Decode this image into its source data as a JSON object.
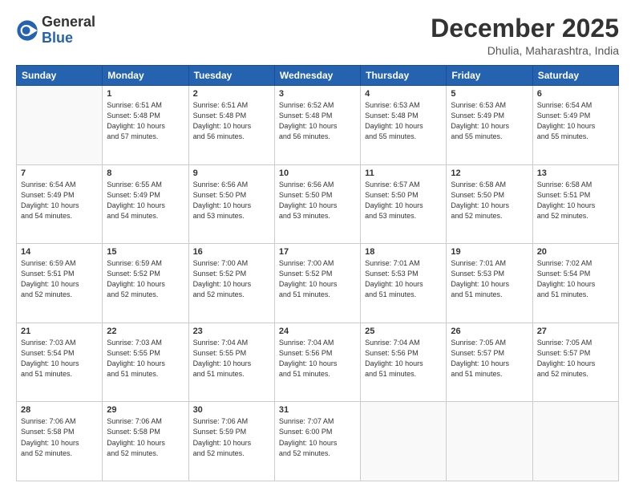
{
  "logo": {
    "general": "General",
    "blue": "Blue"
  },
  "header": {
    "month_year": "December 2025",
    "location": "Dhulia, Maharashtra, India"
  },
  "days_of_week": [
    "Sunday",
    "Monday",
    "Tuesday",
    "Wednesday",
    "Thursday",
    "Friday",
    "Saturday"
  ],
  "weeks": [
    [
      {
        "day": "",
        "info": ""
      },
      {
        "day": "1",
        "info": "Sunrise: 6:51 AM\nSunset: 5:48 PM\nDaylight: 10 hours\nand 57 minutes."
      },
      {
        "day": "2",
        "info": "Sunrise: 6:51 AM\nSunset: 5:48 PM\nDaylight: 10 hours\nand 56 minutes."
      },
      {
        "day": "3",
        "info": "Sunrise: 6:52 AM\nSunset: 5:48 PM\nDaylight: 10 hours\nand 56 minutes."
      },
      {
        "day": "4",
        "info": "Sunrise: 6:53 AM\nSunset: 5:48 PM\nDaylight: 10 hours\nand 55 minutes."
      },
      {
        "day": "5",
        "info": "Sunrise: 6:53 AM\nSunset: 5:49 PM\nDaylight: 10 hours\nand 55 minutes."
      },
      {
        "day": "6",
        "info": "Sunrise: 6:54 AM\nSunset: 5:49 PM\nDaylight: 10 hours\nand 55 minutes."
      }
    ],
    [
      {
        "day": "7",
        "info": "Sunrise: 6:54 AM\nSunset: 5:49 PM\nDaylight: 10 hours\nand 54 minutes."
      },
      {
        "day": "8",
        "info": "Sunrise: 6:55 AM\nSunset: 5:49 PM\nDaylight: 10 hours\nand 54 minutes."
      },
      {
        "day": "9",
        "info": "Sunrise: 6:56 AM\nSunset: 5:50 PM\nDaylight: 10 hours\nand 53 minutes."
      },
      {
        "day": "10",
        "info": "Sunrise: 6:56 AM\nSunset: 5:50 PM\nDaylight: 10 hours\nand 53 minutes."
      },
      {
        "day": "11",
        "info": "Sunrise: 6:57 AM\nSunset: 5:50 PM\nDaylight: 10 hours\nand 53 minutes."
      },
      {
        "day": "12",
        "info": "Sunrise: 6:58 AM\nSunset: 5:50 PM\nDaylight: 10 hours\nand 52 minutes."
      },
      {
        "day": "13",
        "info": "Sunrise: 6:58 AM\nSunset: 5:51 PM\nDaylight: 10 hours\nand 52 minutes."
      }
    ],
    [
      {
        "day": "14",
        "info": "Sunrise: 6:59 AM\nSunset: 5:51 PM\nDaylight: 10 hours\nand 52 minutes."
      },
      {
        "day": "15",
        "info": "Sunrise: 6:59 AM\nSunset: 5:52 PM\nDaylight: 10 hours\nand 52 minutes."
      },
      {
        "day": "16",
        "info": "Sunrise: 7:00 AM\nSunset: 5:52 PM\nDaylight: 10 hours\nand 52 minutes."
      },
      {
        "day": "17",
        "info": "Sunrise: 7:00 AM\nSunset: 5:52 PM\nDaylight: 10 hours\nand 51 minutes."
      },
      {
        "day": "18",
        "info": "Sunrise: 7:01 AM\nSunset: 5:53 PM\nDaylight: 10 hours\nand 51 minutes."
      },
      {
        "day": "19",
        "info": "Sunrise: 7:01 AM\nSunset: 5:53 PM\nDaylight: 10 hours\nand 51 minutes."
      },
      {
        "day": "20",
        "info": "Sunrise: 7:02 AM\nSunset: 5:54 PM\nDaylight: 10 hours\nand 51 minutes."
      }
    ],
    [
      {
        "day": "21",
        "info": "Sunrise: 7:03 AM\nSunset: 5:54 PM\nDaylight: 10 hours\nand 51 minutes."
      },
      {
        "day": "22",
        "info": "Sunrise: 7:03 AM\nSunset: 5:55 PM\nDaylight: 10 hours\nand 51 minutes."
      },
      {
        "day": "23",
        "info": "Sunrise: 7:04 AM\nSunset: 5:55 PM\nDaylight: 10 hours\nand 51 minutes."
      },
      {
        "day": "24",
        "info": "Sunrise: 7:04 AM\nSunset: 5:56 PM\nDaylight: 10 hours\nand 51 minutes."
      },
      {
        "day": "25",
        "info": "Sunrise: 7:04 AM\nSunset: 5:56 PM\nDaylight: 10 hours\nand 51 minutes."
      },
      {
        "day": "26",
        "info": "Sunrise: 7:05 AM\nSunset: 5:57 PM\nDaylight: 10 hours\nand 51 minutes."
      },
      {
        "day": "27",
        "info": "Sunrise: 7:05 AM\nSunset: 5:57 PM\nDaylight: 10 hours\nand 52 minutes."
      }
    ],
    [
      {
        "day": "28",
        "info": "Sunrise: 7:06 AM\nSunset: 5:58 PM\nDaylight: 10 hours\nand 52 minutes."
      },
      {
        "day": "29",
        "info": "Sunrise: 7:06 AM\nSunset: 5:58 PM\nDaylight: 10 hours\nand 52 minutes."
      },
      {
        "day": "30",
        "info": "Sunrise: 7:06 AM\nSunset: 5:59 PM\nDaylight: 10 hours\nand 52 minutes."
      },
      {
        "day": "31",
        "info": "Sunrise: 7:07 AM\nSunset: 6:00 PM\nDaylight: 10 hours\nand 52 minutes."
      },
      {
        "day": "",
        "info": ""
      },
      {
        "day": "",
        "info": ""
      },
      {
        "day": "",
        "info": ""
      }
    ]
  ]
}
